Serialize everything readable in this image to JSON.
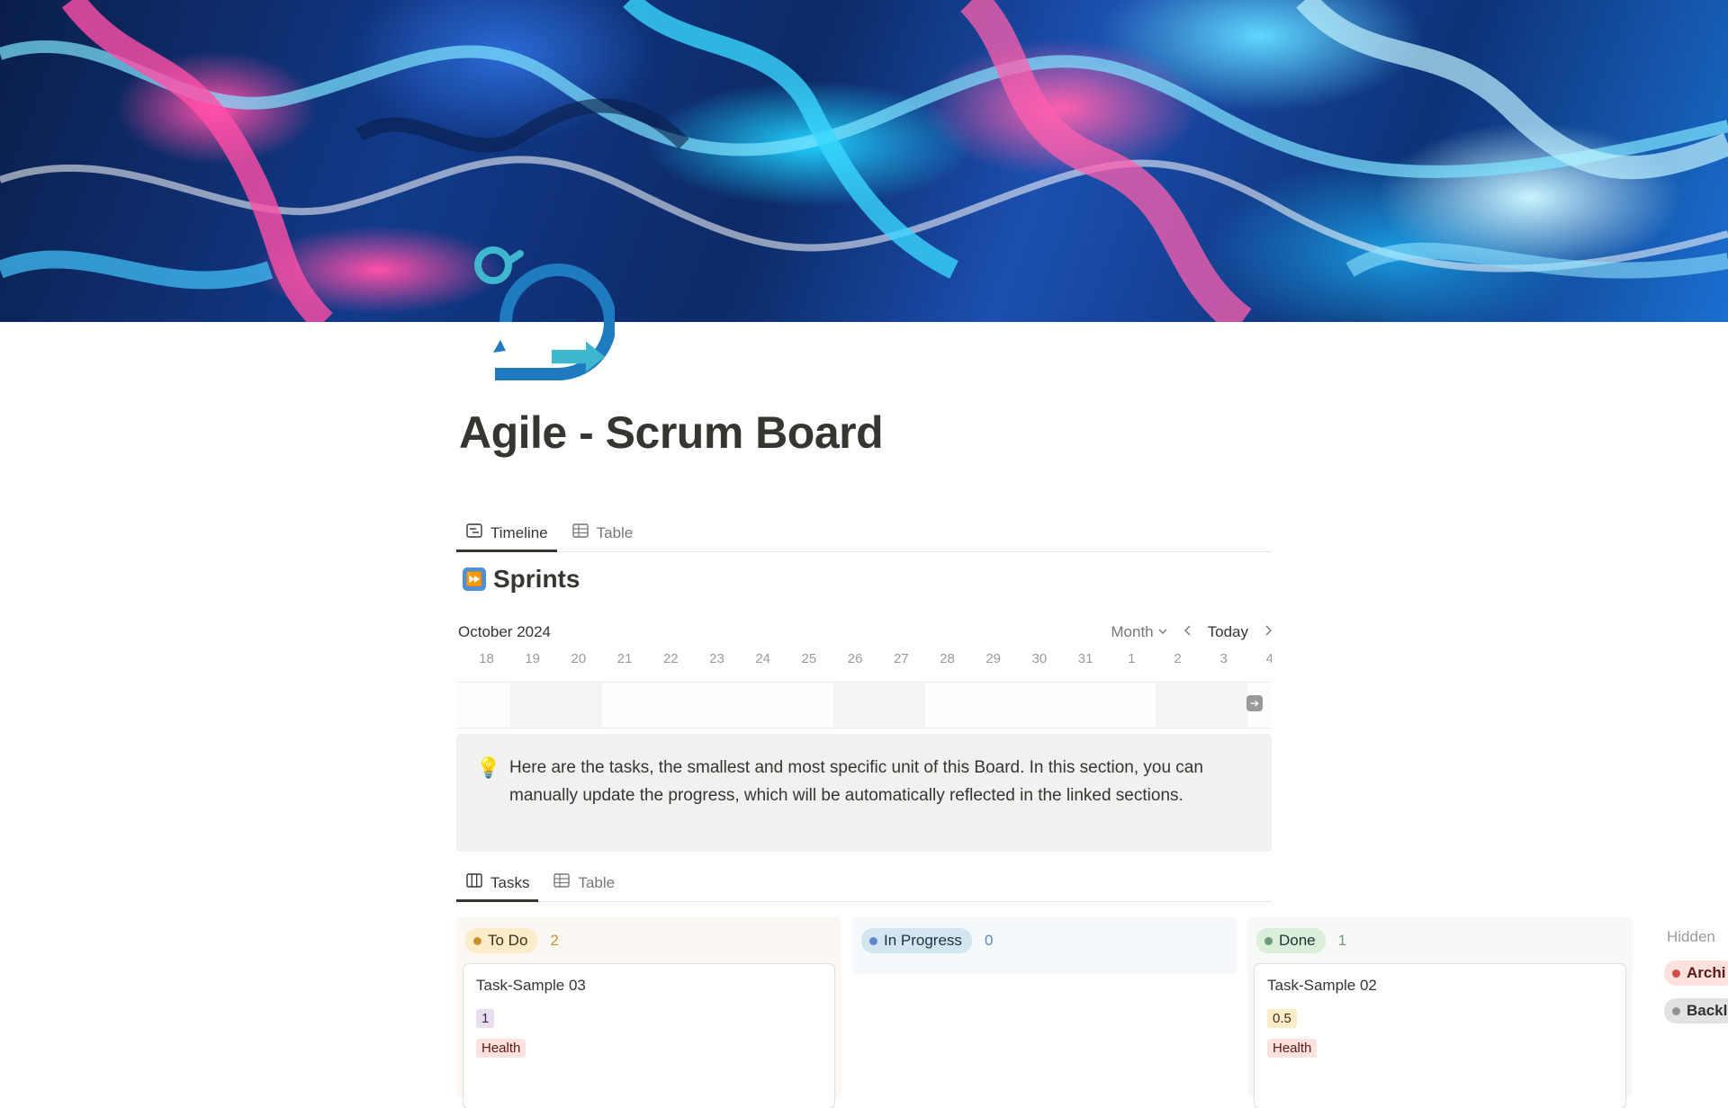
{
  "page": {
    "title": "Agile - Scrum Board"
  },
  "top_tabs": [
    {
      "label": "Timeline",
      "icon": "timeline-icon",
      "active": true
    },
    {
      "label": "Table",
      "icon": "table-icon",
      "active": false
    }
  ],
  "sprints": {
    "heading": "Sprints",
    "heading_icon": "fast-forward-icon",
    "month_label": "October 2024",
    "view_select": "Month",
    "today_label": "Today",
    "days": [
      "18",
      "19",
      "20",
      "21",
      "22",
      "23",
      "24",
      "25",
      "26",
      "27",
      "28",
      "29",
      "30",
      "31",
      "1",
      "2",
      "3",
      "4"
    ]
  },
  "callout": {
    "icon": "lightbulb-icon",
    "text": "Here are the tasks, the smallest and most specific unit of this Board. In this section, you can manually update the progress, which will be automatically reflected in the linked sections."
  },
  "task_tabs": [
    {
      "label": "Tasks",
      "icon": "board-icon",
      "active": true
    },
    {
      "label": "Table",
      "icon": "table-icon",
      "active": false
    }
  ],
  "board": {
    "columns": [
      {
        "status": "To Do",
        "count": "2",
        "colors": {
          "bg": "#fbf8f3",
          "pill": "#fdecc8",
          "dot": "#cb912f",
          "text": "#402c1b",
          "count": "#cb912f"
        },
        "cards": [
          {
            "title": "Task-Sample 03",
            "points": "1",
            "tag": "Health",
            "points_colors": {
              "bg": "#e8deee",
              "text": "#412454"
            }
          }
        ]
      },
      {
        "status": "In Progress",
        "count": "0",
        "colors": {
          "bg": "#f5f9fc",
          "pill": "#d3e5ef",
          "dot": "#5e87c9",
          "text": "#183347",
          "count": "#5e87c9"
        },
        "cards": []
      },
      {
        "status": "Done",
        "count": "1",
        "colors": {
          "bg": "#f6f9f6",
          "pill": "#dbeddb",
          "dot": "#6c9b7d",
          "text": "#1c3829",
          "count": "#6c9b7d"
        },
        "cards": [
          {
            "title": "Task-Sample 02",
            "points": "0.5",
            "tag": "Health",
            "points_colors": {
              "bg": "#fdecc8",
              "text": "#402c1b"
            }
          }
        ]
      }
    ],
    "tag_colors": {
      "bg": "#ffe2dd",
      "text": "#5d1715"
    },
    "hidden": {
      "label": "Hidden",
      "groups": [
        {
          "label": "Archi",
          "pill": "#ffe2dd",
          "dot": "#d44c47",
          "text": "#5d1715"
        },
        {
          "label": "Backl",
          "pill": "#e3e2e0",
          "dot": "#91918e",
          "text": "#32302c"
        }
      ]
    }
  }
}
